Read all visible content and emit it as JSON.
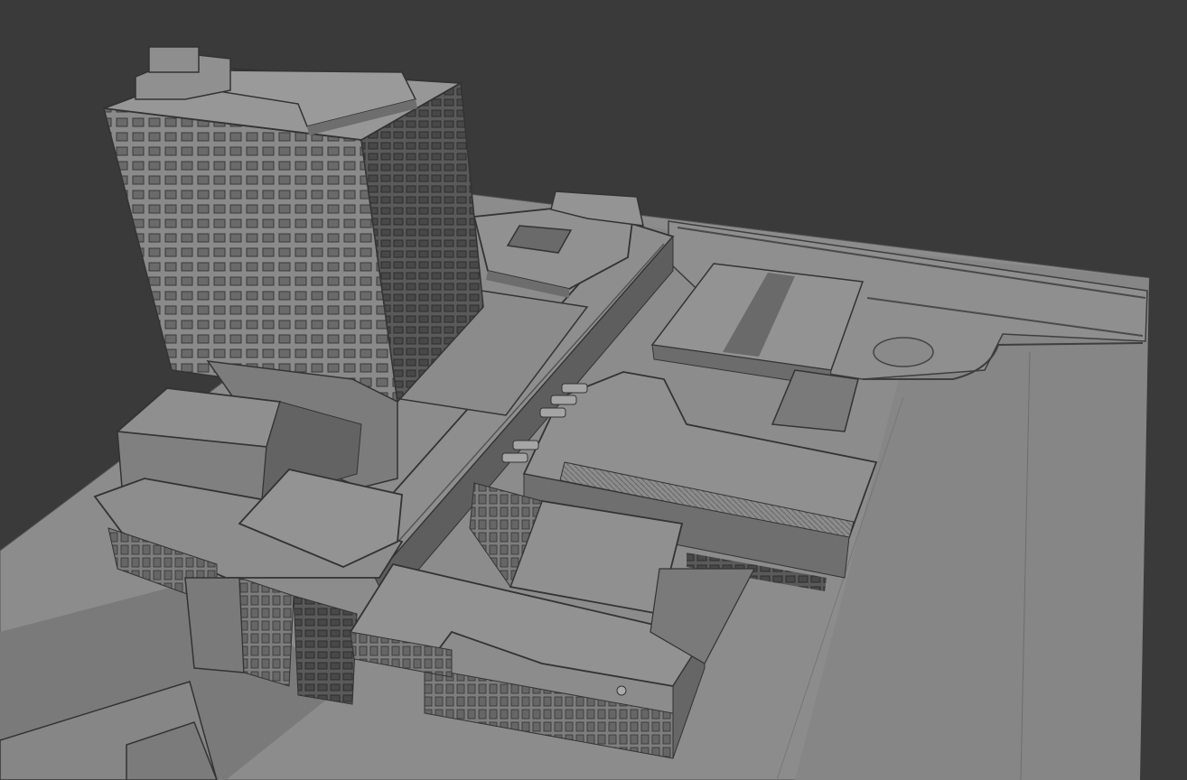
{
  "viewport": {
    "background": "#3a3a3a",
    "solid_shading": {
      "light": "#9a9a9a",
      "mid": "#7d7d7d",
      "dark": "#5c5c5c",
      "edge": "#2e2e2e"
    }
  },
  "scene": {
    "objects": [
      "ground-plane",
      "high-rise-tower",
      "tower-roof-penthouse",
      "podium-block",
      "central-courtyard-building",
      "roof-skylight-strip",
      "long-corridor-building",
      "south-wing",
      "southeast-wing",
      "parking-ramp",
      "sports-pitch-roof",
      "round-plaza",
      "neighbour-block-left",
      "neighbour-block-bottom"
    ]
  }
}
